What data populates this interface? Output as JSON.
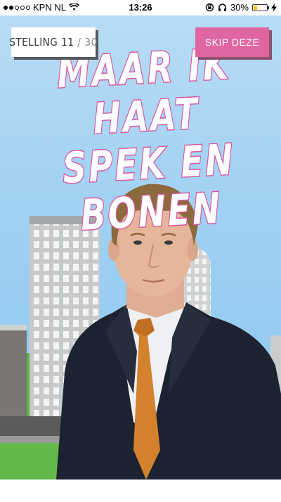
{
  "status_bar": {
    "carrier": "KPN NL",
    "time": "13:26",
    "battery_percent": "30%",
    "battery_level": 0.3,
    "battery_color": "#f5c21b"
  },
  "game": {
    "stelling_label": "STELLING",
    "current": "11",
    "separator": "/",
    "total": "30",
    "skip_label": "SKIP DEZE",
    "statement": "Maar ik haat spek en bonen"
  },
  "colors": {
    "accent_pink": "#e066a0",
    "text_outline": "#d957a0",
    "sky": "#9fd0f2",
    "grass": "#62b949"
  }
}
